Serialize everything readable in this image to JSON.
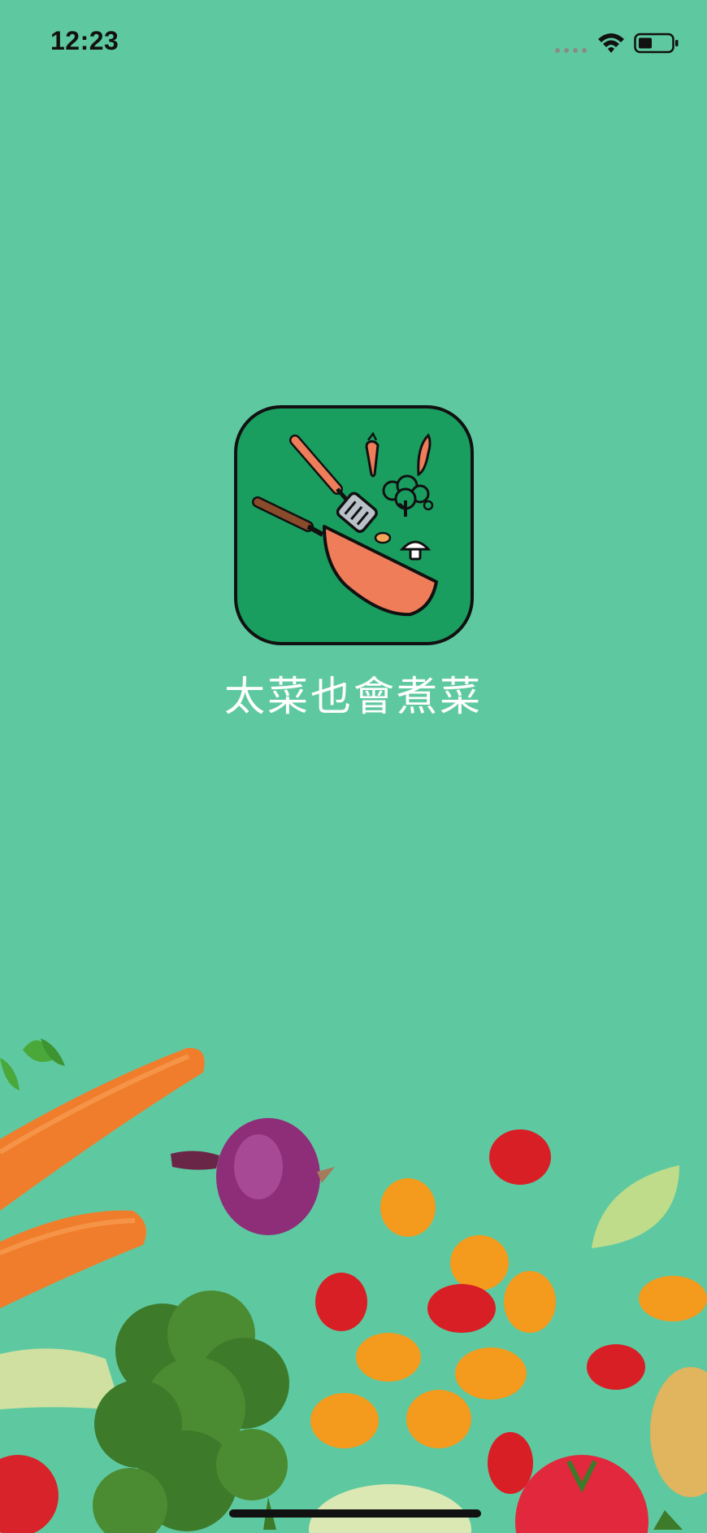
{
  "status_bar": {
    "time": "12:23"
  },
  "splash": {
    "app_name": "太菜也會煮菜",
    "logo_icon": "frying-pan-spatula-icon"
  },
  "decoration": {
    "illustration": "fresh-vegetables"
  },
  "colors": {
    "background": "#5ec9a0",
    "logo_bg": "#1a9e60",
    "pan": "#ef7d5a",
    "text": "#ffffff"
  }
}
